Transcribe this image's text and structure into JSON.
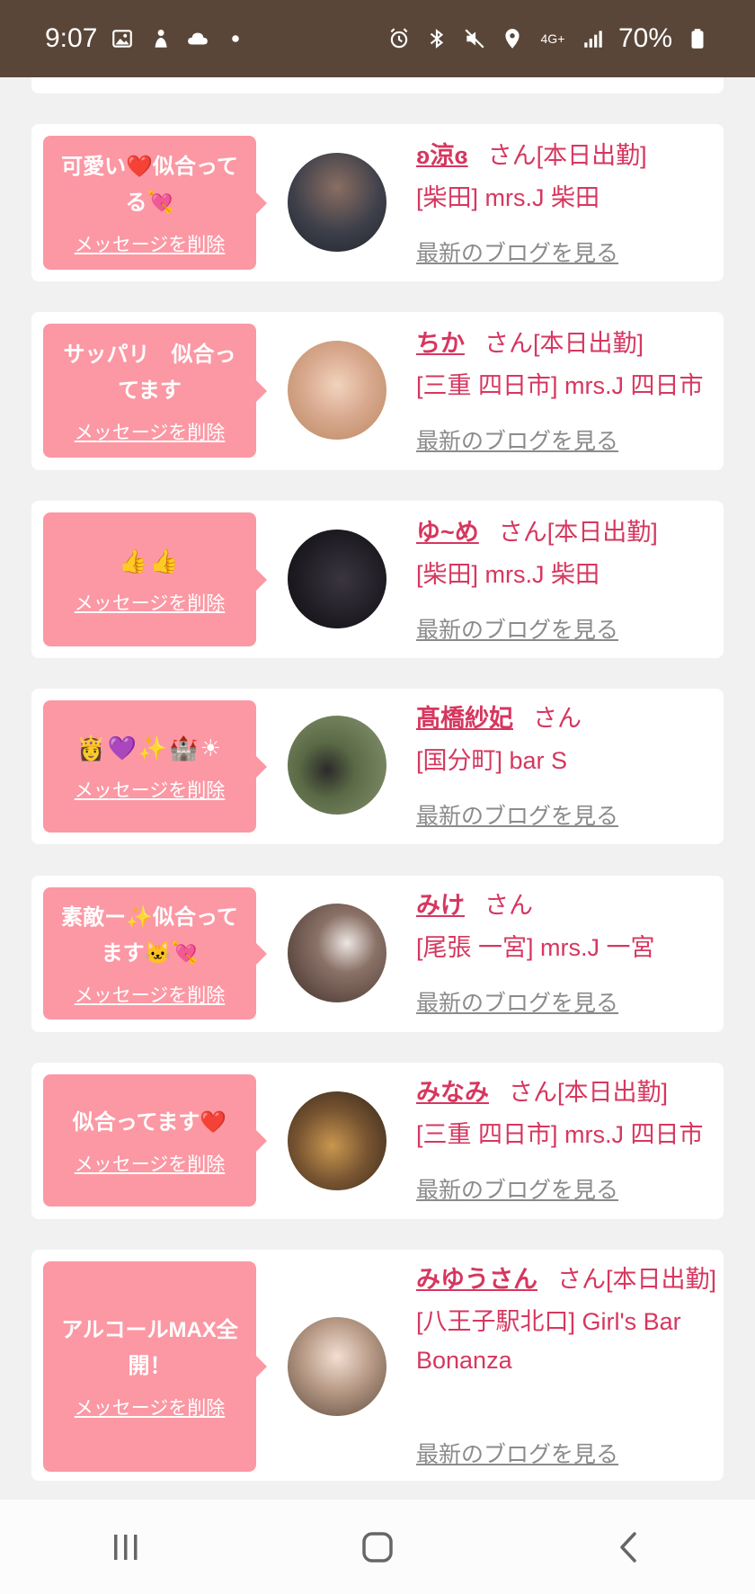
{
  "status_bar": {
    "time": "9:07",
    "battery": "70%",
    "network": "4G+"
  },
  "entries": [
    {
      "message": "可愛い❤️似合ってる💘",
      "delete_label": "メッセージを削除",
      "name": "ʚ涼ɞ",
      "suffix": "さん[本日出勤]",
      "shop": "[柴田] mrs.J 柴田",
      "blog_label": "最新のブログを見る",
      "avatar_color": "#3d3f4a"
    },
    {
      "message": "サッパリ　似合ってます",
      "delete_label": "メッセージを削除",
      "name": "ちか",
      "suffix": "さん[本日出勤]",
      "shop": "[三重 四日市] mrs.J 四日市",
      "blog_label": "最新のブログを見る",
      "avatar_color": "#e9c3a6"
    },
    {
      "message": "👍👍",
      "delete_label": "メッセージを削除",
      "name": "ゆ~め",
      "suffix": "さん[本日出勤]",
      "shop": "[柴田] mrs.J 柴田",
      "blog_label": "最新のブログを見る",
      "avatar_color": "#1e1c22"
    },
    {
      "message": "👸💜✨🏰☀",
      "delete_label": "メッセージを削除",
      "name": "髙橋紗妃",
      "suffix": "さん",
      "shop": "[国分町] bar S",
      "blog_label": "最新のブログを見る",
      "avatar_color": "#6e7a5c"
    },
    {
      "message": "素敵ー✨似合ってます🐱💘",
      "delete_label": "メッセージを削除",
      "name": "みけ",
      "suffix": "さん",
      "shop": "[尾張 一宮] mrs.J 一宮",
      "blog_label": "最新のブログを見る",
      "avatar_color": "#5b4a44"
    },
    {
      "message": "似合ってます❤️",
      "delete_label": "メッセージを削除",
      "name": "みなみ",
      "suffix": "さん[本日出勤]",
      "shop": "[三重 四日市] mrs.J 四日市",
      "blog_label": "最新のブログを見る",
      "avatar_color": "#8a6a44"
    },
    {
      "message": "アルコールMAX全開！",
      "delete_label": "メッセージを削除",
      "name": "みゆうさん",
      "suffix": "さん[本日出勤]",
      "shop": "[八王子駅北口] Girl's Bar Bonanza",
      "blog_label": "最新のブログを見る",
      "avatar_color": "#b79a86"
    }
  ],
  "colors": {
    "status_bar": "#5a4638",
    "bubble": "#fb98a4",
    "accent_text": "#d6375f",
    "link_gray": "#8b8b8b"
  }
}
